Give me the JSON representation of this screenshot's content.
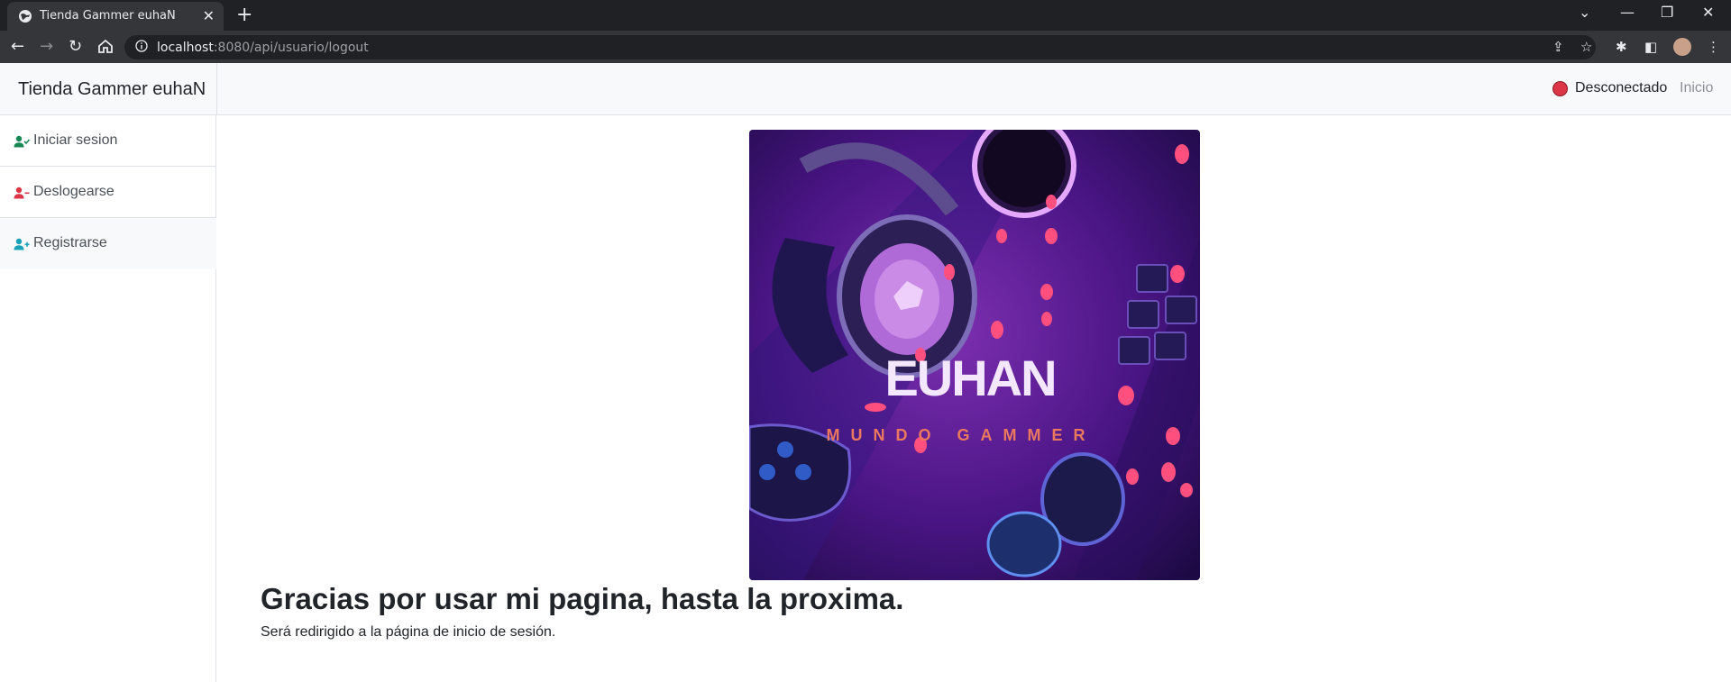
{
  "browser": {
    "tab_title": "Tienda Gammer euhaN",
    "new_tab": "+",
    "url_host": "localhost",
    "url_rest": ":8080/api/usuario/logout",
    "window_controls": [
      "minimize-icon",
      "restore-icon",
      "close-icon"
    ]
  },
  "navbar": {
    "brand": "Tienda Gammer euhaN",
    "status": "Desconectado",
    "status_color": "#dc3545",
    "home_link": "Inicio"
  },
  "sidebar": {
    "items": [
      {
        "label": "Iniciar sesion",
        "icon": "user-check-icon",
        "color": "#198754"
      },
      {
        "label": "Deslogearse",
        "icon": "user-minus-icon",
        "color": "#dc3545"
      },
      {
        "label": "Registrarse",
        "icon": "user-plus-icon",
        "color": "#17a2b8"
      }
    ]
  },
  "hero": {
    "title": "EUHAN",
    "subtitle": "MUNDO GAMMER"
  },
  "main": {
    "heading": "Gracias por usar mi pagina, hasta la proxima.",
    "subtext": "Será redirigido a la página de inicio de sesión."
  }
}
